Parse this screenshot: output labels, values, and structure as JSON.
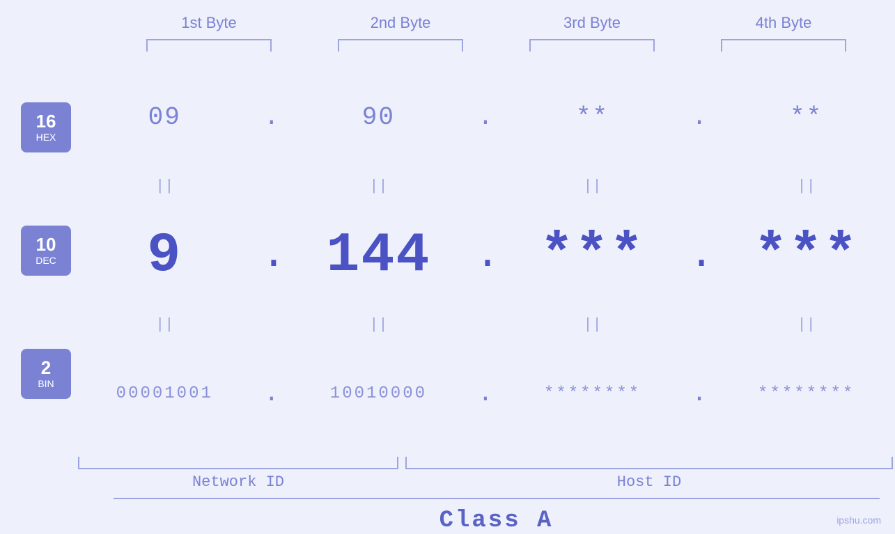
{
  "header": {
    "bytes": [
      "1st Byte",
      "2nd Byte",
      "3rd Byte",
      "4th Byte"
    ]
  },
  "bases": [
    {
      "number": "16",
      "name": "HEX"
    },
    {
      "number": "10",
      "name": "DEC"
    },
    {
      "number": "2",
      "name": "BIN"
    }
  ],
  "rows": {
    "hex": {
      "values": [
        "09",
        "90",
        "**",
        "**"
      ],
      "dots": [
        ".",
        ".",
        ".",
        ""
      ]
    },
    "dec": {
      "values": [
        "9",
        "144",
        "***",
        "***"
      ],
      "dots": [
        ".",
        ".",
        ".",
        ""
      ]
    },
    "bin": {
      "values": [
        "00001001",
        "10010000",
        "********",
        "********"
      ],
      "dots": [
        ".",
        ".",
        ".",
        ""
      ]
    }
  },
  "equals": [
    "||",
    "||",
    "||",
    "||"
  ],
  "labels": {
    "network_id": "Network ID",
    "host_id": "Host ID",
    "class": "Class A"
  },
  "watermark": "ipshu.com"
}
